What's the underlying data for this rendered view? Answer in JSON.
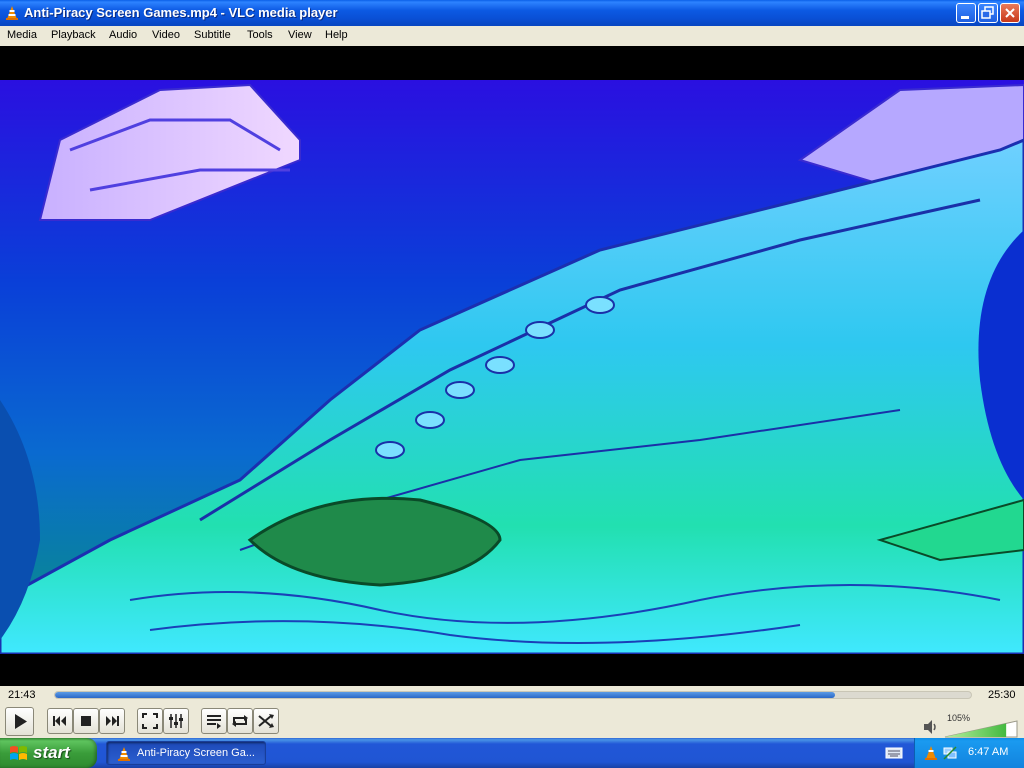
{
  "window": {
    "title": "Anti-Piracy Screen Games.mp4 - VLC media player"
  },
  "menu": {
    "items": [
      "Media",
      "Playback",
      "Audio",
      "Video",
      "Subtitle",
      "Tools",
      "View",
      "Help"
    ]
  },
  "player": {
    "elapsed": "21:43",
    "total": "25:30",
    "progress_fraction": 0.852,
    "volume_label": "105%",
    "volume_fraction": 0.84
  },
  "controls": {
    "icons": [
      "play-icon",
      "previous-icon",
      "stop-icon",
      "next-icon",
      "fullscreen-icon",
      "extended-settings-icon",
      "playlist-icon",
      "loop-icon",
      "shuffle-icon",
      "volume-icon"
    ]
  },
  "taskbar": {
    "start_label": "start",
    "task_label": "Anti-Piracy Screen Ga...",
    "clock": "6:47 AM"
  }
}
